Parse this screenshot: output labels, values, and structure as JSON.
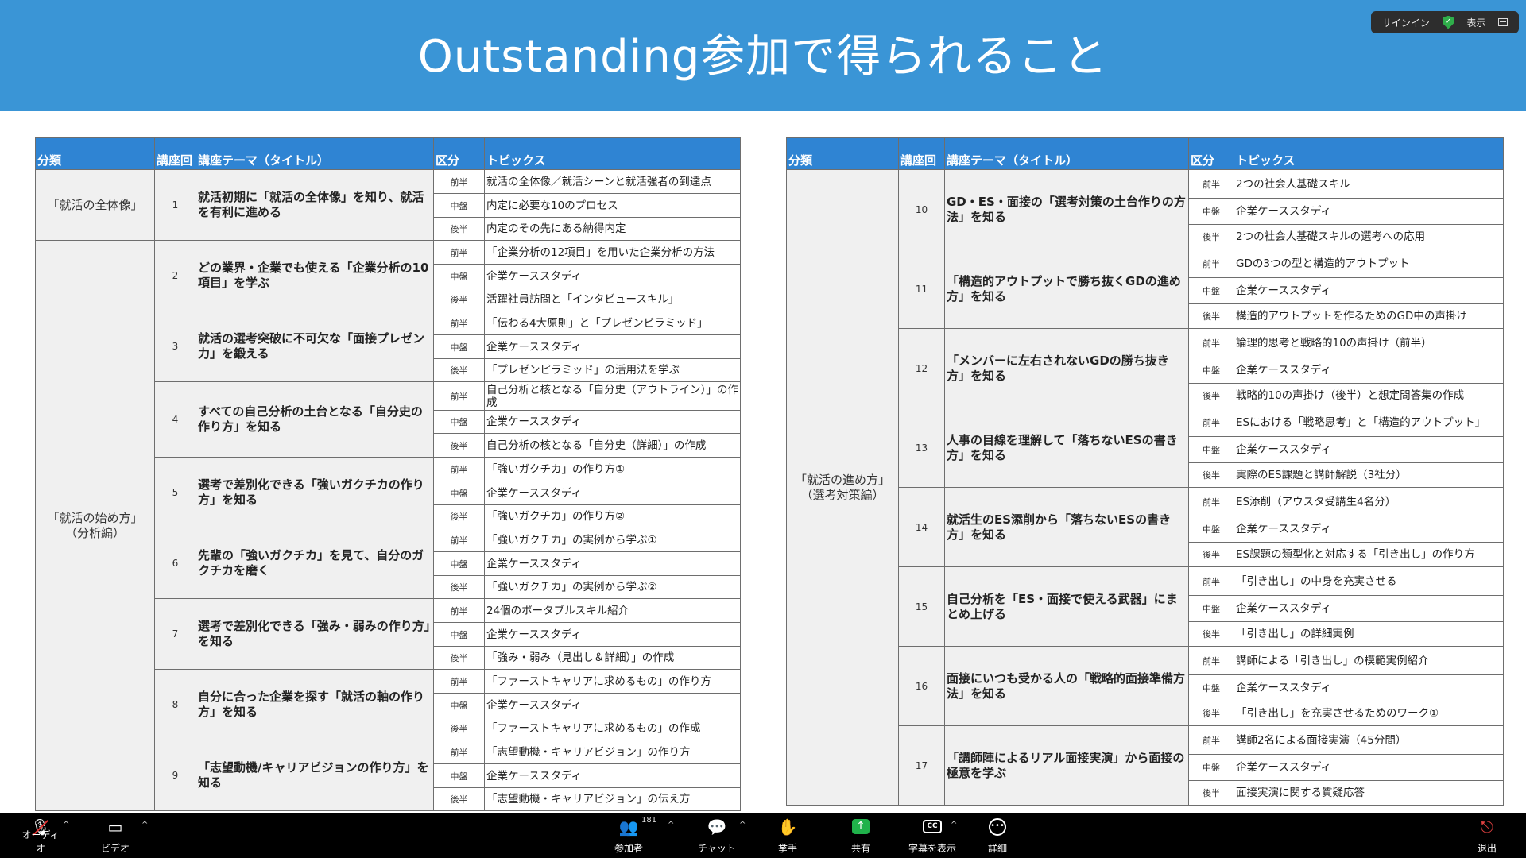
{
  "slide": {
    "title": "Outstanding参加で得られること"
  },
  "overlay": {
    "signin": "サインイン",
    "view": "表示"
  },
  "tables": {
    "headers": {
      "category": "分類",
      "num": "講座回",
      "theme": "講座テーマ（タイトル）",
      "phase": "区分",
      "topic": "トピックス"
    },
    "left": {
      "categories": [
        "「就活の全体像」",
        "「就活の始め方」\n（分析編）"
      ],
      "lectures": [
        {
          "num": "1",
          "theme": "就活初期に「就活の全体像」を知り、就活を有利に進める",
          "topics": [
            "就活の全体像／就活シーンと就活強者の到達点",
            "内定に必要な10のプロセス",
            "内定のその先にある納得内定"
          ]
        },
        {
          "num": "2",
          "theme": "どの業界・企業でも使える「企業分析の10項目」を学ぶ",
          "topics": [
            "「企業分析の12項目」を用いた企業分析の方法",
            "企業ケーススタディ",
            "活躍社員訪問と「インタビュースキル」"
          ]
        },
        {
          "num": "3",
          "theme": "就活の選考突破に不可欠な「面接プレゼン力」を鍛える",
          "topics": [
            "「伝わる4大原則」と「プレゼンピラミッド」",
            "企業ケーススタディ",
            "「プレゼンピラミッド」の活用法を学ぶ"
          ]
        },
        {
          "num": "4",
          "theme": "すべての自己分析の土台となる「自分史の作り方」を知る",
          "topics": [
            "自己分析と核となる「自分史（アウトライン）」の作成",
            "企業ケーススタディ",
            "自己分析の核となる「自分史（詳細）」の作成"
          ]
        },
        {
          "num": "5",
          "theme": "選考で差別化できる「強いガクチカの作り方」を知る",
          "topics": [
            "「強いガクチカ」の作り方①",
            "企業ケーススタディ",
            "「強いガクチカ」の作り方②"
          ]
        },
        {
          "num": "6",
          "theme": "先輩の「強いガクチカ」を見て、自分のガクチカを磨く",
          "topics": [
            "「強いガクチカ」の実例から学ぶ①",
            "企業ケーススタディ",
            "「強いガクチカ」の実例から学ぶ②"
          ]
        },
        {
          "num": "7",
          "theme": "選考で差別化できる「強み・弱みの作り方」を知る",
          "topics": [
            "24個のポータブルスキル紹介",
            "企業ケーススタディ",
            "「強み・弱み（見出し＆詳細）」の作成"
          ]
        },
        {
          "num": "8",
          "theme": "自分に合った企業を探す「就活の軸の作り方」を知る",
          "topics": [
            "「ファーストキャリアに求めるもの」の作り方",
            "企業ケーススタディ",
            "「ファーストキャリアに求めるもの」の作成"
          ]
        },
        {
          "num": "9",
          "theme": "「志望動機/キャリアビジョンの作り方」を知る",
          "topics": [
            "「志望動機・キャリアビジョン」の作り方",
            "企業ケーススタディ",
            "「志望動機・キャリアビジョン」の伝え方"
          ]
        }
      ]
    },
    "right": {
      "category": "「就活の進め方」\n（選考対策編）",
      "lectures": [
        {
          "num": "10",
          "theme": "GD・ES・面接の「選考対策の土台作りの方法」を知る",
          "topics": [
            "2つの社会人基礎スキル",
            "企業ケーススタディ",
            "2つの社会人基礎スキルの選考への応用"
          ]
        },
        {
          "num": "11",
          "theme": "「構造的アウトプットで勝ち抜くGDの進め方」を知る",
          "topics": [
            "GDの3つの型と構造的アウトプット",
            "企業ケーススタディ",
            "構造的アウトプットを作るためのGD中の声掛け"
          ]
        },
        {
          "num": "12",
          "theme": "「メンバーに左右されないGDの勝ち抜き方」を知る",
          "topics": [
            "論理的思考と戦略的10の声掛け（前半）",
            "企業ケーススタディ",
            "戦略的10の声掛け（後半）と想定問答集の作成"
          ]
        },
        {
          "num": "13",
          "theme": "人事の目線を理解して「落ちないESの書き方」を知る",
          "topics": [
            "ESにおける「戦略思考」と「構造的アウトプット」",
            "企業ケーススタディ",
            "実際のES課題と講師解説（3社分）"
          ]
        },
        {
          "num": "14",
          "theme": "就活生のES添削から「落ちないESの書き方」を知る",
          "topics": [
            "ES添削（アウスタ受講生4名分）",
            "企業ケーススタディ",
            "ES課題の類型化と対応する「引き出し」の作り方"
          ]
        },
        {
          "num": "15",
          "theme": "自己分析を「ES・面接で使える武器」にまとめ上げる",
          "topics": [
            "「引き出し」の中身を充実させる",
            "企業ケーススタディ",
            "「引き出し」の詳細実例"
          ]
        },
        {
          "num": "16",
          "theme": "面接にいつも受かる人の「戦略的面接準備方法」を知る",
          "topics": [
            "講師による「引き出し」の模範実例紹介",
            "企業ケーススタディ",
            "「引き出し」を充実させるためのワーク①"
          ]
        },
        {
          "num": "17",
          "theme": "「講師陣によるリアル面接実演」から面接の極意を学ぶ",
          "topics": [
            "講師2名による面接実演（45分間）",
            "企業ケーススタディ",
            "面接実演に関する質疑応答"
          ]
        }
      ]
    },
    "phases": [
      "前半",
      "中盤",
      "後半"
    ]
  },
  "toolbar": {
    "audio": "オーディオ",
    "video": "ビデオ",
    "participants": "参加者",
    "participants_count": "181",
    "chat": "チャット",
    "raise_hand": "挙手",
    "share": "共有",
    "captions": "字幕を表示",
    "more": "詳細",
    "leave": "退出"
  }
}
